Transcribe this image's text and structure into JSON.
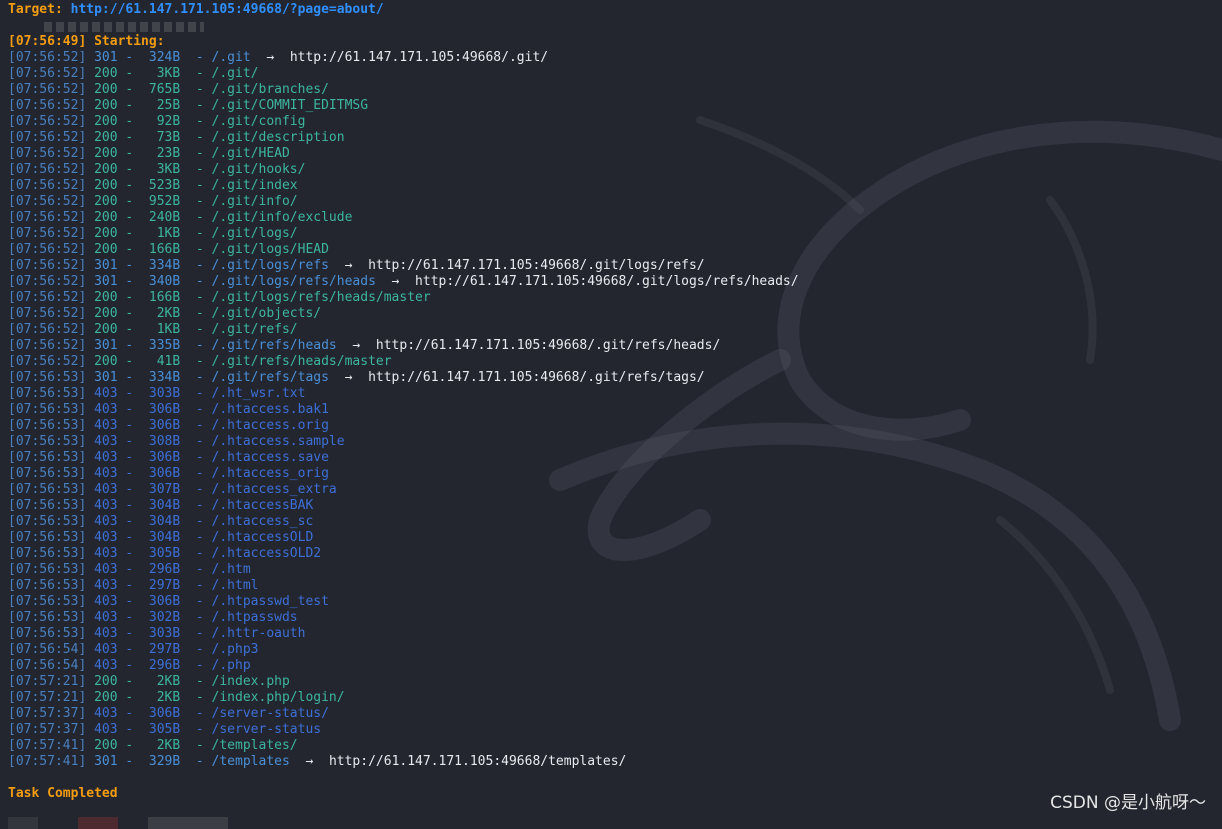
{
  "header": {
    "target_label": "Target:",
    "target_url": "http://61.147.171.105:49668/?page=about/",
    "starting": "[07:56:49] Starting:"
  },
  "results": [
    {
      "ts": "[07:56:52]",
      "code": "301",
      "size": "324B",
      "path": "/.git",
      "redirect": "http://61.147.171.105:49668/.git/"
    },
    {
      "ts": "[07:56:52]",
      "code": "200",
      "size": "3KB",
      "path": "/.git/",
      "redirect": ""
    },
    {
      "ts": "[07:56:52]",
      "code": "200",
      "size": "765B",
      "path": "/.git/branches/",
      "redirect": ""
    },
    {
      "ts": "[07:56:52]",
      "code": "200",
      "size": "25B",
      "path": "/.git/COMMIT_EDITMSG",
      "redirect": ""
    },
    {
      "ts": "[07:56:52]",
      "code": "200",
      "size": "92B",
      "path": "/.git/config",
      "redirect": ""
    },
    {
      "ts": "[07:56:52]",
      "code": "200",
      "size": "73B",
      "path": "/.git/description",
      "redirect": ""
    },
    {
      "ts": "[07:56:52]",
      "code": "200",
      "size": "23B",
      "path": "/.git/HEAD",
      "redirect": ""
    },
    {
      "ts": "[07:56:52]",
      "code": "200",
      "size": "3KB",
      "path": "/.git/hooks/",
      "redirect": ""
    },
    {
      "ts": "[07:56:52]",
      "code": "200",
      "size": "523B",
      "path": "/.git/index",
      "redirect": ""
    },
    {
      "ts": "[07:56:52]",
      "code": "200",
      "size": "952B",
      "path": "/.git/info/",
      "redirect": ""
    },
    {
      "ts": "[07:56:52]",
      "code": "200",
      "size": "240B",
      "path": "/.git/info/exclude",
      "redirect": ""
    },
    {
      "ts": "[07:56:52]",
      "code": "200",
      "size": "1KB",
      "path": "/.git/logs/",
      "redirect": ""
    },
    {
      "ts": "[07:56:52]",
      "code": "200",
      "size": "166B",
      "path": "/.git/logs/HEAD",
      "redirect": ""
    },
    {
      "ts": "[07:56:52]",
      "code": "301",
      "size": "334B",
      "path": "/.git/logs/refs",
      "redirect": "http://61.147.171.105:49668/.git/logs/refs/"
    },
    {
      "ts": "[07:56:52]",
      "code": "301",
      "size": "340B",
      "path": "/.git/logs/refs/heads",
      "redirect": "http://61.147.171.105:49668/.git/logs/refs/heads/"
    },
    {
      "ts": "[07:56:52]",
      "code": "200",
      "size": "166B",
      "path": "/.git/logs/refs/heads/master",
      "redirect": ""
    },
    {
      "ts": "[07:56:52]",
      "code": "200",
      "size": "2KB",
      "path": "/.git/objects/",
      "redirect": ""
    },
    {
      "ts": "[07:56:52]",
      "code": "200",
      "size": "1KB",
      "path": "/.git/refs/",
      "redirect": ""
    },
    {
      "ts": "[07:56:52]",
      "code": "301",
      "size": "335B",
      "path": "/.git/refs/heads",
      "redirect": "http://61.147.171.105:49668/.git/refs/heads/"
    },
    {
      "ts": "[07:56:52]",
      "code": "200",
      "size": "41B",
      "path": "/.git/refs/heads/master",
      "redirect": ""
    },
    {
      "ts": "[07:56:53]",
      "code": "301",
      "size": "334B",
      "path": "/.git/refs/tags",
      "redirect": "http://61.147.171.105:49668/.git/refs/tags/"
    },
    {
      "ts": "[07:56:53]",
      "code": "403",
      "size": "303B",
      "path": "/.ht_wsr.txt",
      "redirect": ""
    },
    {
      "ts": "[07:56:53]",
      "code": "403",
      "size": "306B",
      "path": "/.htaccess.bak1",
      "redirect": ""
    },
    {
      "ts": "[07:56:53]",
      "code": "403",
      "size": "306B",
      "path": "/.htaccess.orig",
      "redirect": ""
    },
    {
      "ts": "[07:56:53]",
      "code": "403",
      "size": "308B",
      "path": "/.htaccess.sample",
      "redirect": ""
    },
    {
      "ts": "[07:56:53]",
      "code": "403",
      "size": "306B",
      "path": "/.htaccess.save",
      "redirect": ""
    },
    {
      "ts": "[07:56:53]",
      "code": "403",
      "size": "306B",
      "path": "/.htaccess_orig",
      "redirect": ""
    },
    {
      "ts": "[07:56:53]",
      "code": "403",
      "size": "307B",
      "path": "/.htaccess_extra",
      "redirect": ""
    },
    {
      "ts": "[07:56:53]",
      "code": "403",
      "size": "304B",
      "path": "/.htaccessBAK",
      "redirect": ""
    },
    {
      "ts": "[07:56:53]",
      "code": "403",
      "size": "304B",
      "path": "/.htaccess_sc",
      "redirect": ""
    },
    {
      "ts": "[07:56:53]",
      "code": "403",
      "size": "304B",
      "path": "/.htaccessOLD",
      "redirect": ""
    },
    {
      "ts": "[07:56:53]",
      "code": "403",
      "size": "305B",
      "path": "/.htaccessOLD2",
      "redirect": ""
    },
    {
      "ts": "[07:56:53]",
      "code": "403",
      "size": "296B",
      "path": "/.htm",
      "redirect": ""
    },
    {
      "ts": "[07:56:53]",
      "code": "403",
      "size": "297B",
      "path": "/.html",
      "redirect": ""
    },
    {
      "ts": "[07:56:53]",
      "code": "403",
      "size": "306B",
      "path": "/.htpasswd_test",
      "redirect": ""
    },
    {
      "ts": "[07:56:53]",
      "code": "403",
      "size": "302B",
      "path": "/.htpasswds",
      "redirect": ""
    },
    {
      "ts": "[07:56:53]",
      "code": "403",
      "size": "303B",
      "path": "/.httr-oauth",
      "redirect": ""
    },
    {
      "ts": "[07:56:54]",
      "code": "403",
      "size": "297B",
      "path": "/.php3",
      "redirect": ""
    },
    {
      "ts": "[07:56:54]",
      "code": "403",
      "size": "296B",
      "path": "/.php",
      "redirect": ""
    },
    {
      "ts": "[07:57:21]",
      "code": "200",
      "size": "2KB",
      "path": "/index.php",
      "redirect": ""
    },
    {
      "ts": "[07:57:21]",
      "code": "200",
      "size": "2KB",
      "path": "/index.php/login/",
      "redirect": ""
    },
    {
      "ts": "[07:57:37]",
      "code": "403",
      "size": "306B",
      "path": "/server-status/",
      "redirect": ""
    },
    {
      "ts": "[07:57:37]",
      "code": "403",
      "size": "305B",
      "path": "/server-status",
      "redirect": ""
    },
    {
      "ts": "[07:57:41]",
      "code": "200",
      "size": "2KB",
      "path": "/templates/",
      "redirect": ""
    },
    {
      "ts": "[07:57:41]",
      "code": "301",
      "size": "329B",
      "path": "/templates",
      "redirect": "http://61.147.171.105:49668/templates/"
    }
  ],
  "footer": {
    "task_completed": "Task Completed"
  },
  "watermark": "CSDN @是小航呀～",
  "colors": {
    "background": "#23262f",
    "orange": "#f39c12",
    "target_url": "#2f8fff",
    "status_200": "#3db5a0",
    "status_301": "#4a8fd6",
    "status_403": "#3d6fd6",
    "timestamp": "#4a7fbf"
  }
}
